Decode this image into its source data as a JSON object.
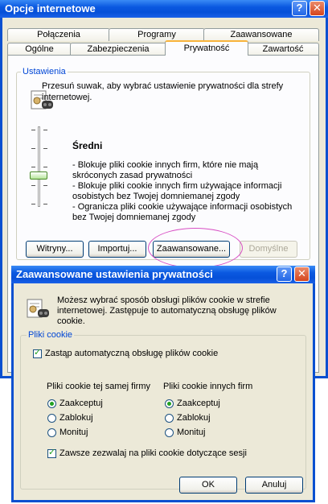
{
  "outer": {
    "title": "Opcje internetowe",
    "tabs_row1": [
      "Połączenia",
      "Programy",
      "Zaawansowane"
    ],
    "tabs_row2": [
      "Ogólne",
      "Zabezpieczenia",
      "Prywatność",
      "Zawartość"
    ],
    "active_tab": "Prywatność",
    "settings_group": "Ustawienia",
    "settings_desc": [
      "Przesuń suwak, aby wybrać ustawienie prywatności dla strefy",
      "internetowej."
    ],
    "level_title": "Średni",
    "level_lines": [
      "- Blokuje pliki cookie innych firm, które nie mają",
      "skróconych zasad prywatności",
      "- Blokuje pliki cookie innych firm używające informacji",
      "osobistych bez Twojej domniemanej zgody",
      "- Ogranicza pliki cookie używające informacji osobistych",
      "bez Twojej domniemanej zgody"
    ],
    "buttons": {
      "sites": "Witryny...",
      "import": "Importuj...",
      "advanced": "Zaawansowane...",
      "default": "Domyślne"
    },
    "slider_level": 0.45
  },
  "dialog": {
    "title": "Zaawansowane ustawienia prywatności",
    "desc": [
      "Możesz wybrać sposób obsługi plików cookie w strefie",
      "internetowej. Zastępuje to automatyczną obsługę plików",
      "cookie."
    ],
    "group": "Pliki cookie",
    "override_label": "Zastąp automatyczną obsługę plików cookie",
    "override_checked": true,
    "first_party": {
      "header": "Pliki cookie tej samej firmy",
      "options": [
        "Zaakceptuj",
        "Zablokuj",
        "Monituj"
      ],
      "selected": "Zaakceptuj"
    },
    "third_party": {
      "header": "Pliki cookie innych firm",
      "options": [
        "Zaakceptuj",
        "Zablokuj",
        "Monituj"
      ],
      "selected": "Zaakceptuj"
    },
    "session_label": "Zawsze zezwalaj na pliki cookie dotyczące sesji",
    "session_checked": true,
    "ok": "OK",
    "cancel": "Anuluj"
  },
  "colors": {
    "title_blue": "#0650d8",
    "accent_tab": "#f8b33b",
    "group_label": "#0046d5",
    "highlight": "#d84fc4"
  }
}
